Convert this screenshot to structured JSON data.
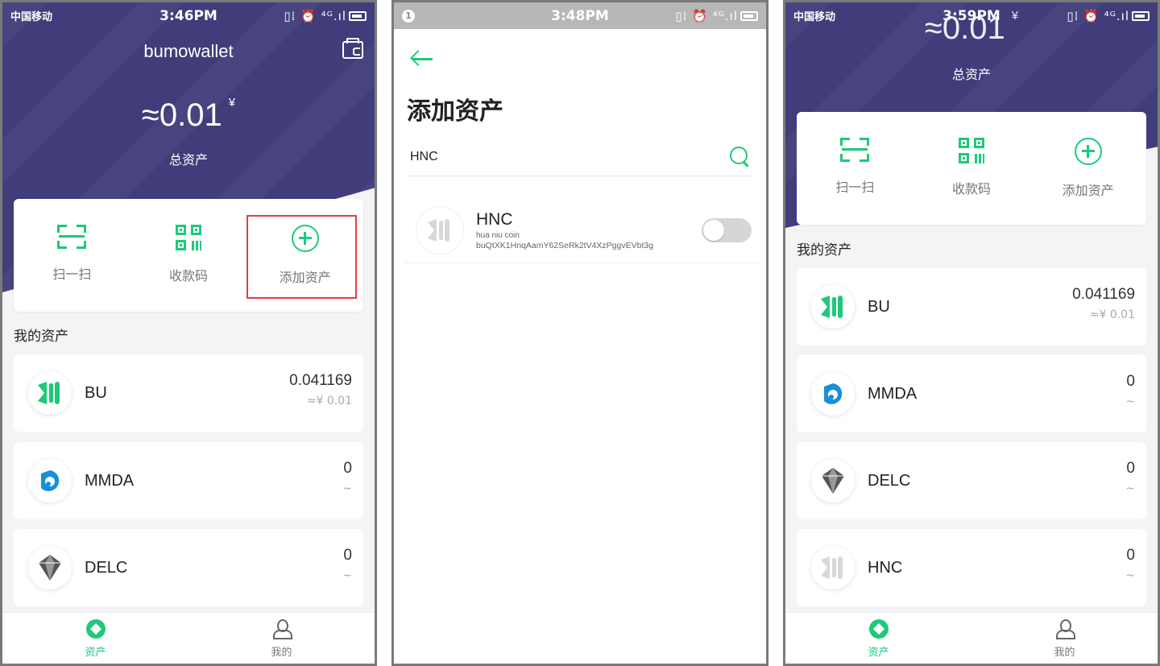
{
  "phone1": {
    "status": {
      "carrier": "中国移动",
      "time": "3:46PM",
      "icons": "▯⁞ ⏰ ⁴ᴳ.ıl"
    },
    "app_title": "bumowallet",
    "total_value": "≈0.01",
    "currency_symbol": "¥",
    "total_label": "总资产",
    "actions": [
      "扫一扫",
      "收款码",
      "添加资产"
    ],
    "section_title": "我的资产",
    "assets": [
      {
        "name": "BU",
        "amount": "0.041169",
        "fiat": "≈¥ 0.01"
      },
      {
        "name": "MMDA",
        "amount": "0",
        "fiat": "~"
      },
      {
        "name": "DELC",
        "amount": "0",
        "fiat": "~"
      }
    ],
    "tabs": [
      "资产",
      "我的"
    ]
  },
  "phone2": {
    "status": {
      "notif": "1",
      "time": "3:48PM",
      "icons": "▯⁞ ⏰ ⁴ᴳ.ıl"
    },
    "title": "添加资产",
    "search_value": "HNC",
    "result": {
      "symbol": "HNC",
      "full_name": "hua niu coin",
      "address": "buQtXK1HnqAamY62SeRk2tV4XzPggvEVbt3g"
    }
  },
  "phone3": {
    "status": {
      "carrier": "中国移动",
      "time": "3:59PM",
      "icons": "▯⁞ ⏰ ⁴ᴳ.ıl"
    },
    "total_value": "≈0.01",
    "currency_symbol": "¥",
    "total_label": "总资产",
    "actions": [
      "扫一扫",
      "收款码",
      "添加资产"
    ],
    "section_title": "我的资产",
    "assets": [
      {
        "name": "BU",
        "amount": "0.041169",
        "fiat": "≈¥ 0.01"
      },
      {
        "name": "MMDA",
        "amount": "0",
        "fiat": "~"
      },
      {
        "name": "DELC",
        "amount": "0",
        "fiat": "~"
      },
      {
        "name": "HNC",
        "amount": "0",
        "fiat": "~"
      }
    ],
    "tabs": [
      "资产",
      "我的"
    ]
  },
  "colors": {
    "accent": "#1ec97a",
    "hero": "#413c7a",
    "highlight": "#e04040",
    "mmda": "#1a8fd6"
  }
}
